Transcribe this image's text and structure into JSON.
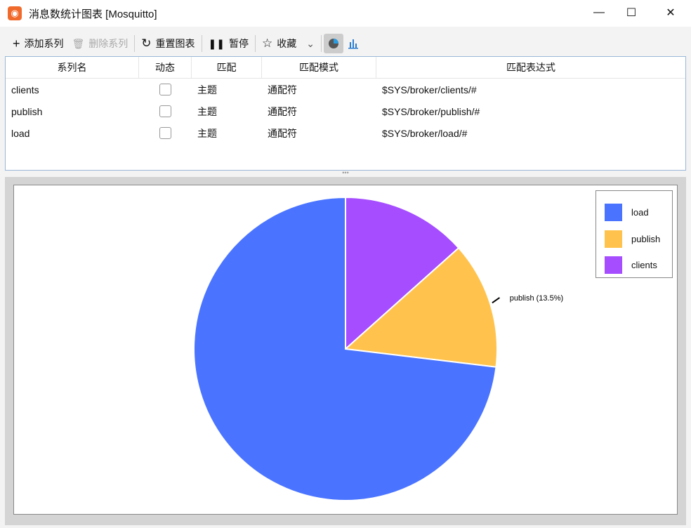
{
  "window": {
    "title": "消息数统计图表 [Mosquitto]",
    "minimize": "—",
    "maximize": "☐",
    "close": "✕"
  },
  "toolbar": {
    "add": "添加系列",
    "delete": "删除系列",
    "reset": "重置图表",
    "pause": "暂停",
    "favorite": "收藏"
  },
  "table": {
    "headers": [
      "系列名",
      "动态",
      "匹配",
      "匹配模式",
      "匹配表达式"
    ],
    "rows": [
      {
        "name": "clients",
        "dynamic": false,
        "match": "主题",
        "mode": "通配符",
        "expr": "$SYS/broker/clients/#"
      },
      {
        "name": "publish",
        "dynamic": false,
        "match": "主题",
        "mode": "通配符",
        "expr": "$SYS/broker/publish/#"
      },
      {
        "name": "load",
        "dynamic": false,
        "match": "主题",
        "mode": "通配符",
        "expr": "$SYS/broker/load/#"
      }
    ]
  },
  "splitter": "•••",
  "chart_data": {
    "type": "pie",
    "start": "top",
    "direction": "clockwise",
    "slices": [
      {
        "name": "clients",
        "value": 13.4,
        "color": "#a54dff"
      },
      {
        "name": "publish",
        "value": 13.5,
        "color": "#ffc34d",
        "label": "publish (13.5%)"
      },
      {
        "name": "load",
        "value": 73.1,
        "color": "#4a74ff"
      }
    ],
    "legend": {
      "position": "top-right",
      "entries": [
        "load",
        "publish",
        "clients"
      ]
    }
  }
}
